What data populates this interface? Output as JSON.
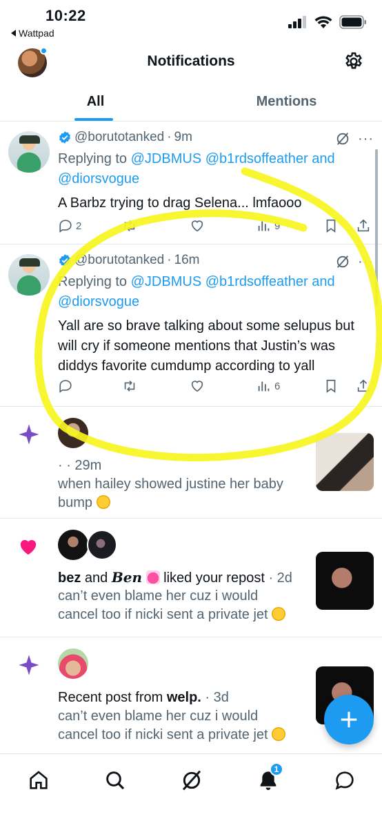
{
  "status": {
    "time": "10:22",
    "back_label": "Wattpad"
  },
  "header": {
    "title": "Notifications"
  },
  "tabs": [
    {
      "label": "All",
      "active": true
    },
    {
      "label": "Mentions",
      "active": false
    }
  ],
  "tweets": [
    {
      "handle": "@borutotanked",
      "time": "9m",
      "replying_prefix": "Replying to ",
      "replying_to": [
        "@JDBMUS",
        "@b1rdsoffeather",
        "and",
        "@diorsvogue"
      ],
      "text": "A Barbz trying to drag Selena... lmfaooo",
      "replies": "2",
      "views": "9"
    },
    {
      "handle": "@borutotanked",
      "time": "16m",
      "replying_prefix": "Replying to ",
      "replying_to": [
        "@JDBMUS",
        "@b1rdsoffeather",
        "and",
        "@diorsvogue"
      ],
      "text_lines": [
        "Yall are so brave talking about some selupus but",
        "will cry if someone mentions that Justin’s was",
        "diddys favorite cumdump according to yall"
      ],
      "replies": "",
      "views": "6"
    }
  ],
  "notifications": [
    {
      "type": "recent-post",
      "meta": "· · 29m",
      "lines": [
        "when hailey showed justine her baby",
        "bump"
      ]
    },
    {
      "type": "like",
      "user1": "bez",
      "conj": "and",
      "user2": "Ben",
      "action": "liked your repost",
      "time": "· 2d",
      "lines": [
        "can’t even blame her cuz i would",
        "cancel too if nicki sent a private jet"
      ]
    },
    {
      "type": "recent-post",
      "prefix": "Recent post from ",
      "user": "welp.",
      "time": "· 3d",
      "lines": [
        "can’t even blame her cuz i would",
        "cancel too if nicki sent a private jet"
      ]
    }
  ],
  "bottom_nav": {
    "notifications_badge": "1"
  },
  "colors": {
    "accent": "#1d9bf0",
    "text": "#0f1419",
    "muted": "#536471",
    "like": "#f91880",
    "sparkle": "#794bc4",
    "highlighter": "#f7f520"
  },
  "icons": [
    "back-arrow-icon",
    "signal-icon",
    "wifi-icon",
    "battery-icon",
    "gear-icon",
    "verified-icon",
    "grok-icon",
    "more-icon",
    "reply-icon",
    "repost-icon",
    "like-icon",
    "views-icon",
    "bookmark-icon",
    "share-icon",
    "sparkle-icon",
    "heart-icon",
    "plus-icon",
    "home-icon",
    "search-icon",
    "notifications-icon",
    "messages-icon"
  ]
}
